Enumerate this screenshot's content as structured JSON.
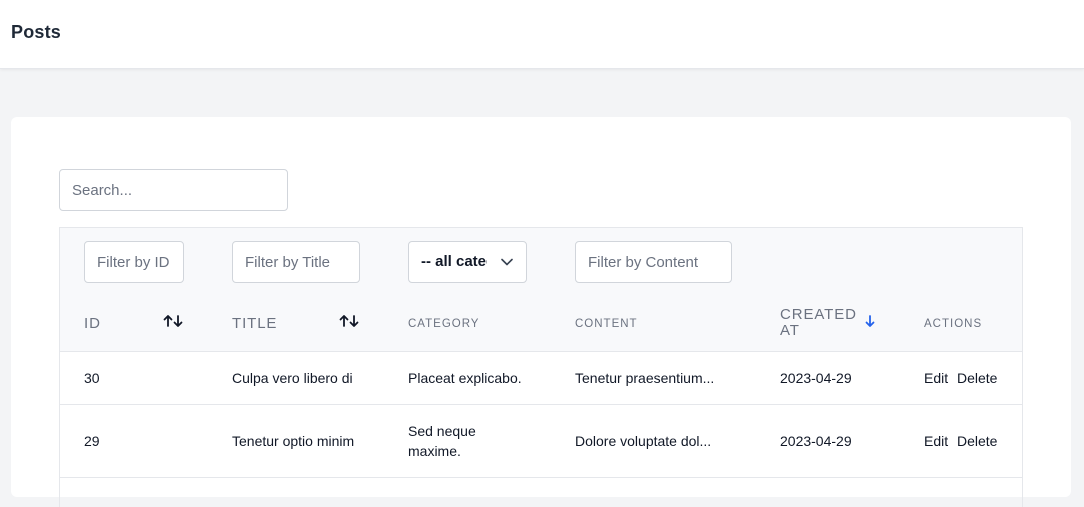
{
  "header": {
    "title": "Posts"
  },
  "search": {
    "placeholder": "Search..."
  },
  "filters": {
    "id_placeholder": "Filter by ID",
    "title_placeholder": "Filter by Title",
    "category_selected": "-- all categories --",
    "content_placeholder": "Filter by Content"
  },
  "columns": {
    "id": "ID",
    "title": "TITLE",
    "category": "CATEGORY",
    "content": "CONTENT",
    "created_at_line1": "CREATED",
    "created_at_line2": "AT",
    "actions": "ACTIONS"
  },
  "icons": {
    "sort_id": "sort-arrows-icon",
    "sort_title": "sort-arrows-icon",
    "sort_created": "arrow-down-icon",
    "select_chevron": "chevron-down-icon"
  },
  "colors": {
    "accent": "#2563eb"
  },
  "rows": [
    {
      "id": "30",
      "title": "Culpa vero libero di",
      "category_line1": "Placeat explicabo.",
      "category_line2": "",
      "content": "Tenetur praesentium...",
      "created_at": "2023-04-29",
      "edit": "Edit",
      "delete": "Delete"
    },
    {
      "id": "29",
      "title": "Tenetur optio minim",
      "category_line1": "Sed neque",
      "category_line2": "maxime.",
      "content": "Dolore voluptate dol...",
      "created_at": "2023-04-29",
      "edit": "Edit",
      "delete": "Delete"
    }
  ]
}
